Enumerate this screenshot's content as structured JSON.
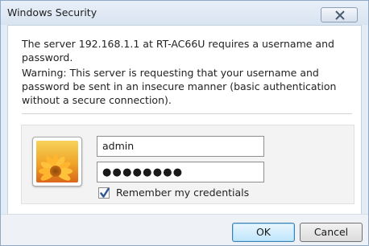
{
  "window": {
    "title": "Windows Security",
    "close_symbol": "✕"
  },
  "message": {
    "line1": "The server 192.168.1.1 at RT-AC66U requires a username and password.",
    "warning": "Warning: This server is requesting that your username and password be sent in an insecure manner (basic authentication without a secure connection)."
  },
  "credentials": {
    "username": "admin",
    "password_masked": "●●●●●●●●",
    "remember_label": "Remember my credentials",
    "remember_checked": true,
    "user_tile_icon": "flower-user-picture-icon"
  },
  "buttons": {
    "ok": "OK",
    "cancel": "Cancel"
  },
  "colors": {
    "accent_border": "#3c7fb1",
    "ok_fill": "#bee6fd",
    "check_color": "#2b5797"
  }
}
